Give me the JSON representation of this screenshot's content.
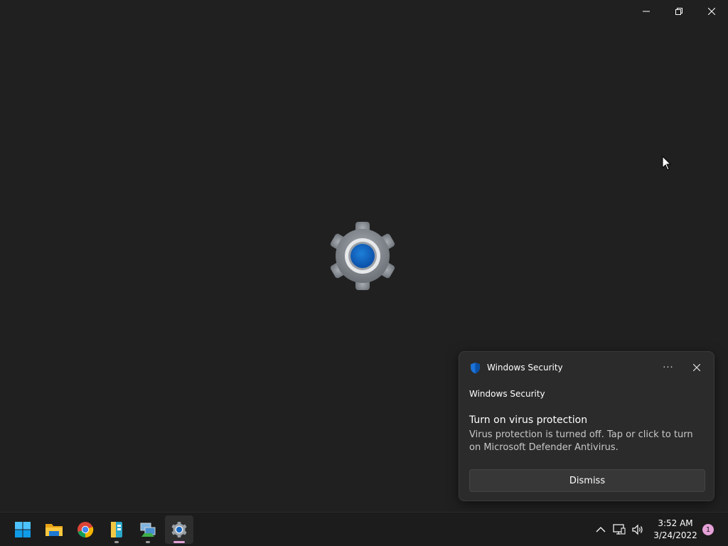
{
  "window": {
    "caption_icons": [
      "minimize-icon",
      "restore-icon",
      "close-icon"
    ]
  },
  "splash": {
    "icon": "settings-gear-icon"
  },
  "toast": {
    "app_name": "Windows Security",
    "attribution": "Windows Security",
    "title": "Turn on virus protection",
    "body": "Virus protection is turned off. Tap or click to turn on Microsoft Defender Antivirus.",
    "more_label": "···",
    "dismiss_label": "Dismiss",
    "icon": "shield-icon"
  },
  "taskbar": {
    "apps": [
      {
        "icon": "windows-start-icon"
      },
      {
        "icon": "file-explorer-icon"
      },
      {
        "icon": "chrome-icon"
      },
      {
        "icon": "archive-app-icon"
      },
      {
        "icon": "network-app-icon"
      },
      {
        "icon": "settings-icon"
      }
    ]
  },
  "tray": {
    "time": "3:52 AM",
    "date": "3/24/2022",
    "notification_count": "1"
  },
  "colors": {
    "accent": "#0067c0",
    "background": "#202020",
    "badge": "#e5a1d8"
  }
}
